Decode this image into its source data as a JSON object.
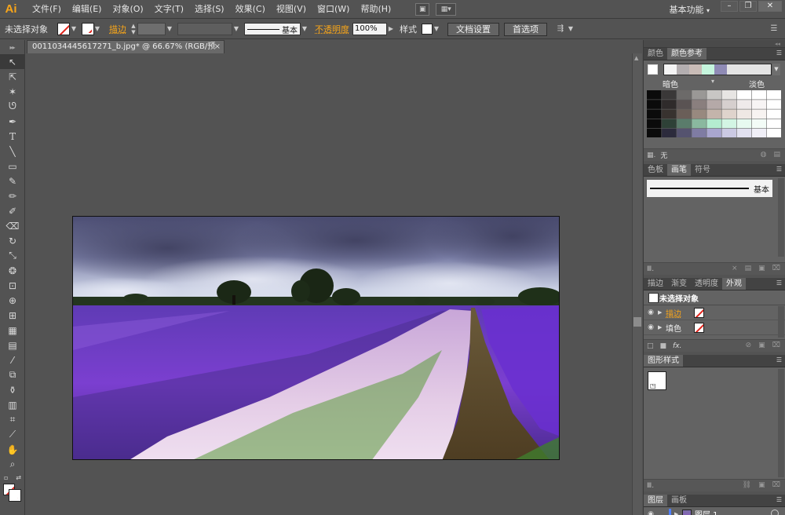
{
  "app": {
    "logo": "Ai",
    "workspace": "基本功能"
  },
  "menu": [
    "文件(F)",
    "编辑(E)",
    "对象(O)",
    "文字(T)",
    "选择(S)",
    "效果(C)",
    "视图(V)",
    "窗口(W)",
    "帮助(H)"
  ],
  "window_controls": {
    "minimize": "–",
    "restore": "❐",
    "close": "✕"
  },
  "control_bar": {
    "selection": "未选择对象",
    "stroke_label": "描边",
    "stroke_style": "基本",
    "opacity_label": "不透明度",
    "opacity_value": "100%",
    "style_label": "样式",
    "doc_setup": "文档设置",
    "preferences": "首选项"
  },
  "document": {
    "tab_title": "0011034445617271_b.jpg* @ 66.67% (RGB/预览)",
    "close": "×"
  },
  "panels": {
    "color_guide": {
      "tabs": [
        "颜色",
        "颜色参考"
      ],
      "active_tab": 1,
      "dark_label": "暗色",
      "light_label": "淡色",
      "footer_text": "无",
      "harmony_colors": [
        "#f4f4f4",
        "#b3aeb0",
        "#c9bcb7",
        "#c5f5dd",
        "#8f8bb5"
      ],
      "grid_rows": [
        [
          "#0b0b0b",
          "#3a3838",
          "#6c6a69",
          "#9a9896",
          "#c8c6c4",
          "#e7e5e3",
          "#ffffff",
          "#ffffff",
          "#ffffff"
        ],
        [
          "#0b0b0b",
          "#2f2b2b",
          "#5a5353",
          "#8a7f7e",
          "#b5a9a8",
          "#d6cfce",
          "#efeaea",
          "#f7f4f4",
          "#ffffff"
        ],
        [
          "#0b0b0b",
          "#38322f",
          "#6a5e58",
          "#98897f",
          "#c4b4ab",
          "#dfd3cc",
          "#efe8e4",
          "#f7f3f1",
          "#ffffff"
        ],
        [
          "#0b0b0b",
          "#2e4137",
          "#5a7c6b",
          "#8ab89f",
          "#b4ecd0",
          "#d3f5e4",
          "#e7faf0",
          "#f3fcf7",
          "#ffffff"
        ],
        [
          "#0b0b0b",
          "#2c2b3c",
          "#55536f",
          "#7f7ca3",
          "#a9a6cf",
          "#cbc9e3",
          "#e1e0ef",
          "#f0eff7",
          "#ffffff"
        ]
      ]
    },
    "swatches_tabs": [
      "色板",
      "画笔",
      "符号"
    ],
    "swatches_active": 1,
    "brush_name": "基本",
    "appearance": {
      "tabs": [
        "描边",
        "渐变",
        "透明度",
        "外观"
      ],
      "active_tab": 3,
      "title": "未选择对象",
      "rows": [
        {
          "label": "描边",
          "link": true
        },
        {
          "label": "填色",
          "link": false
        }
      ],
      "fx": "fx."
    },
    "graphic_styles": {
      "tabs": [
        "图形样式"
      ]
    },
    "layers": {
      "tabs": [
        "图层",
        "画板"
      ],
      "active_tab": 0,
      "layer_name": "图层 1"
    }
  }
}
